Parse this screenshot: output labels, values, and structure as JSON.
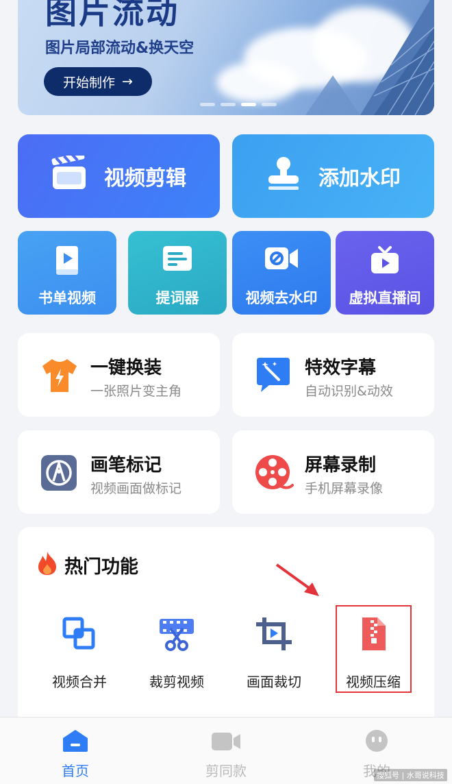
{
  "banner": {
    "title": "图片流动",
    "subtitle": "图片局部流动&换天空",
    "button_label": "开始制作",
    "button_arrow": "→",
    "page_indicator": {
      "count": 4,
      "active": 3
    }
  },
  "big_cards": [
    {
      "label": "视频剪辑",
      "icon": "clapperboard-icon"
    },
    {
      "label": "添加水印",
      "icon": "stamp-icon"
    }
  ],
  "tiles": [
    {
      "label": "书单视频",
      "icon": "book-video-icon"
    },
    {
      "label": "提词器",
      "icon": "teleprompter-icon"
    },
    {
      "label": "视频去水印",
      "icon": "video-watermark-remove-icon"
    },
    {
      "label": "虚拟直播间",
      "icon": "tv-live-icon"
    }
  ],
  "features": [
    {
      "title": "一键换装",
      "subtitle": "一张照片变主角",
      "icon": "tshirt-icon"
    },
    {
      "title": "特效字幕",
      "subtitle": "自动识别&动效",
      "icon": "magic-subtitle-icon"
    },
    {
      "title": "画笔标记",
      "subtitle": "视频画面做标记",
      "icon": "pen-mark-icon"
    },
    {
      "title": "屏幕录制",
      "subtitle": "手机屏幕录像",
      "icon": "film-reel-icon"
    }
  ],
  "hot": {
    "title": "热门功能",
    "items": [
      {
        "label": "视频合并",
        "icon": "merge-icon"
      },
      {
        "label": "裁剪视频",
        "icon": "cut-video-icon"
      },
      {
        "label": "画面裁切",
        "icon": "crop-icon"
      },
      {
        "label": "视频压缩",
        "icon": "zip-file-icon"
      }
    ]
  },
  "tabbar": {
    "active": "首页",
    "items": [
      {
        "label": "首页",
        "icon": "home-icon"
      },
      {
        "label": "剪同款",
        "icon": "video-camera-icon"
      },
      {
        "label": "我的",
        "icon": "profile-face-icon"
      }
    ]
  },
  "watermark": "搜狐号 | 水哥说科技",
  "colors": {
    "accent": "#2e7df6",
    "highlight_box": "#e3333b",
    "hot_flame": "#f04a2a"
  }
}
